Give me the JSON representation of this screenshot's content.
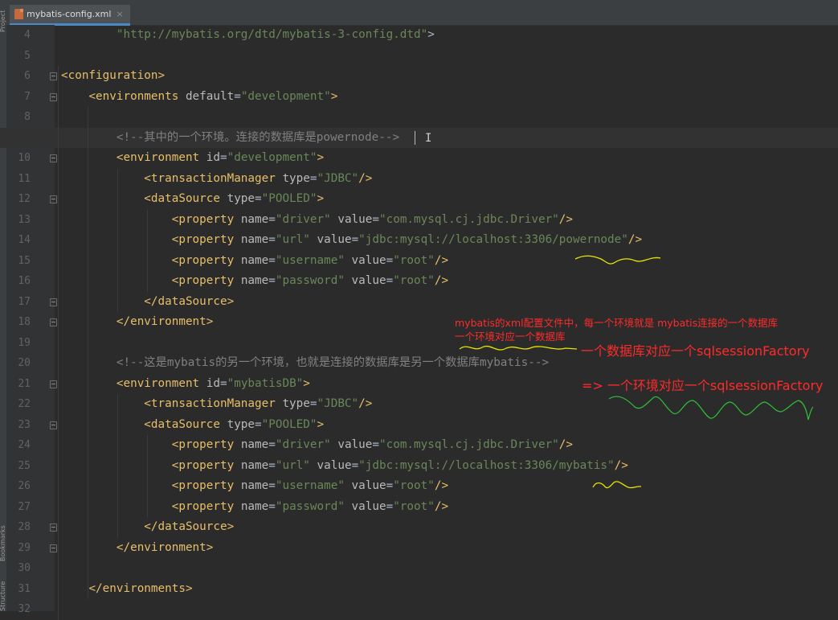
{
  "side_panel": {
    "top_label": "Project",
    "bottom_labels": [
      "Bookmarks",
      "Structure"
    ]
  },
  "tab": {
    "filename": "mybatis-config.xml",
    "icon": "xml-file-icon",
    "close": "×"
  },
  "editor": {
    "current_line": 9,
    "lines": [
      {
        "num": "4",
        "html": "        <span class=\"v\">\"http://mybatis.org/dtd/mybatis-3-config.dtd\"</span>&gt;"
      },
      {
        "num": "5",
        "html": ""
      },
      {
        "num": "6",
        "html": "<span class=\"t\">&lt;configuration&gt;</span>"
      },
      {
        "num": "7",
        "html": "    <span class=\"t\">&lt;environments </span><span class=\"a\">default</span>=<span class=\"v\">\"development\"</span><span class=\"t\">&gt;</span>"
      },
      {
        "num": "8",
        "html": ""
      },
      {
        "num": "9",
        "html": "        <span class=\"c\">&lt;!--其中的一个环境。连接的数据库是powernode--&gt;</span>"
      },
      {
        "num": "10",
        "html": "        <span class=\"t\">&lt;environment </span><span class=\"a\">id</span>=<span class=\"v\">\"development\"</span><span class=\"t\">&gt;</span>"
      },
      {
        "num": "11",
        "html": "            <span class=\"t\">&lt;transactionManager </span><span class=\"a\">type</span>=<span class=\"v\">\"JDBC\"</span><span class=\"t\">/&gt;</span>"
      },
      {
        "num": "12",
        "html": "            <span class=\"t\">&lt;dataSource </span><span class=\"a\">type</span>=<span class=\"v\">\"POOLED\"</span><span class=\"t\">&gt;</span>"
      },
      {
        "num": "13",
        "html": "                <span class=\"t\">&lt;property </span><span class=\"a\">name</span>=<span class=\"v\">\"driver\"</span> <span class=\"a\">value</span>=<span class=\"v\">\"com.mysql.cj.jdbc.Driver\"</span><span class=\"t\">/&gt;</span>"
      },
      {
        "num": "14",
        "html": "                <span class=\"t\">&lt;property </span><span class=\"a\">name</span>=<span class=\"v\">\"url\"</span> <span class=\"a\">value</span>=<span class=\"v\">\"jdbc:mysql://localhost:3306/powernode\"</span><span class=\"t\">/&gt;</span>"
      },
      {
        "num": "15",
        "html": "                <span class=\"t\">&lt;property </span><span class=\"a\">name</span>=<span class=\"v\">\"username\"</span> <span class=\"a\">value</span>=<span class=\"v\">\"root\"</span><span class=\"t\">/&gt;</span>"
      },
      {
        "num": "16",
        "html": "                <span class=\"t\">&lt;property </span><span class=\"a\">name</span>=<span class=\"v\">\"password\"</span> <span class=\"a\">value</span>=<span class=\"v\">\"root\"</span><span class=\"t\">/&gt;</span>"
      },
      {
        "num": "17",
        "html": "            <span class=\"t\">&lt;/dataSource&gt;</span>"
      },
      {
        "num": "18",
        "html": "        <span class=\"t\">&lt;/environment&gt;</span>"
      },
      {
        "num": "19",
        "html": ""
      },
      {
        "num": "20",
        "html": "        <span class=\"c\">&lt;!--这是mybatis的另一个环境，也就是连接的数据库是另一个数据库mybatis--&gt;</span>"
      },
      {
        "num": "21",
        "html": "        <span class=\"t\">&lt;environment </span><span class=\"a\">id</span>=<span class=\"v\">\"mybatisDB\"</span><span class=\"t\">&gt;</span>"
      },
      {
        "num": "22",
        "html": "            <span class=\"t\">&lt;transactionManager </span><span class=\"a\">type</span>=<span class=\"v\">\"JDBC\"</span><span class=\"t\">/&gt;</span>"
      },
      {
        "num": "23",
        "html": "            <span class=\"t\">&lt;dataSource </span><span class=\"a\">type</span>=<span class=\"v\">\"POOLED\"</span><span class=\"t\">&gt;</span>"
      },
      {
        "num": "24",
        "html": "                <span class=\"t\">&lt;property </span><span class=\"a\">name</span>=<span class=\"v\">\"driver\"</span> <span class=\"a\">value</span>=<span class=\"v\">\"com.mysql.cj.jdbc.Driver\"</span><span class=\"t\">/&gt;</span>"
      },
      {
        "num": "25",
        "html": "                <span class=\"t\">&lt;property </span><span class=\"a\">name</span>=<span class=\"v\">\"url\"</span> <span class=\"a\">value</span>=<span class=\"v\">\"jdbc:mysql://localhost:3306/mybatis\"</span><span class=\"t\">/&gt;</span>"
      },
      {
        "num": "26",
        "html": "                <span class=\"t\">&lt;property </span><span class=\"a\">name</span>=<span class=\"v\">\"username\"</span> <span class=\"a\">value</span>=<span class=\"v\">\"root\"</span><span class=\"t\">/&gt;</span>"
      },
      {
        "num": "27",
        "html": "                <span class=\"t\">&lt;property </span><span class=\"a\">name</span>=<span class=\"v\">\"password\"</span> <span class=\"a\">value</span>=<span class=\"v\">\"root\"</span><span class=\"t\">/&gt;</span>"
      },
      {
        "num": "28",
        "html": "            <span class=\"t\">&lt;/dataSource&gt;</span>"
      },
      {
        "num": "29",
        "html": "        <span class=\"t\">&lt;/environment&gt;</span>"
      },
      {
        "num": "30",
        "html": ""
      },
      {
        "num": "31",
        "html": "    <span class=\"t\">&lt;/environments&gt;</span>"
      },
      {
        "num": "32",
        "html": ""
      }
    ]
  },
  "annotations": {
    "note1": "mybatis的xml配置文件中，每一个环境就是 mybatis连接的一个数据库",
    "note2": "一个环境对应一个数据库",
    "note3": "一个数据库对应一个sqlsessionFactory",
    "note4": "=>  一个环境对应一个sqlsessionFactory"
  },
  "colors": {
    "background": "#2b2b2b",
    "tag": "#e8bf6a",
    "attribute": "#bababa",
    "string": "#6a8759",
    "comment": "#808080",
    "annotation_red": "#ff2b2b",
    "scribble_yellow": "#e6e600",
    "scribble_green": "#2fbf3a"
  }
}
